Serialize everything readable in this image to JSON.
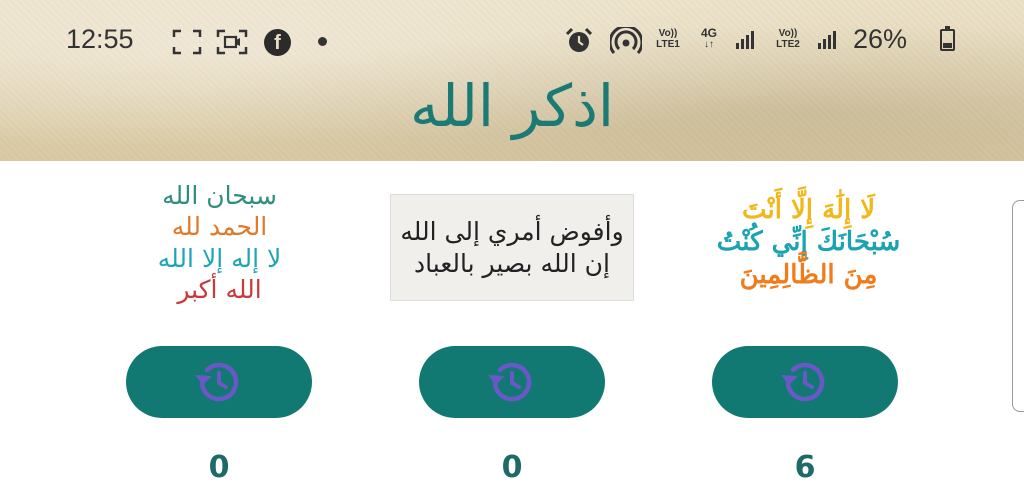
{
  "status_bar": {
    "time": "12:55",
    "net1_top": "Vo))",
    "net1_bottom": "LTE1",
    "net_4g_top": "4G",
    "net_4g_bottom": "↓↑",
    "net2_top": "Vo))",
    "net2_bottom": "LTE2",
    "battery": "26%",
    "battery_level": 0.26,
    "icons": [
      "screenshot-icon",
      "screen-record-icon",
      "facebook-icon",
      "notification-dot-icon",
      "alarm-icon",
      "hotspot-icon",
      "signal-icon",
      "signal-icon",
      "battery-icon"
    ]
  },
  "header": {
    "title": "اذكر الله"
  },
  "cards": [
    {
      "lines": [
        "سبحان الله",
        "الحمد لله",
        "لا إله إلا الله",
        "الله أكبر"
      ],
      "colors": [
        "#2f8f7c",
        "#e07a2a",
        "#1fa6b5",
        "#c93a3a"
      ],
      "count": "0"
    },
    {
      "lines": [
        "وأفوض أمري إلى الله",
        "إن الله بصير بالعباد"
      ],
      "colors": [
        "#222222",
        "#222222"
      ],
      "count": "0"
    },
    {
      "lines": [
        "لَا إِلَٰهَ إِلَّا أَنْتَ",
        "سُبْحَانَكَ إِنِّي كُنْتُ",
        "مِنَ الظَّالِمِينَ"
      ],
      "colors": [
        "#f2b71b",
        "#1ba3b2",
        "#f07c1c"
      ],
      "count": "6"
    }
  ],
  "button_icon": "history-icon",
  "colors": {
    "accent": "#127872",
    "title": "#1b7a74",
    "icon": "#6a58c8",
    "count": "#1d6a66"
  }
}
